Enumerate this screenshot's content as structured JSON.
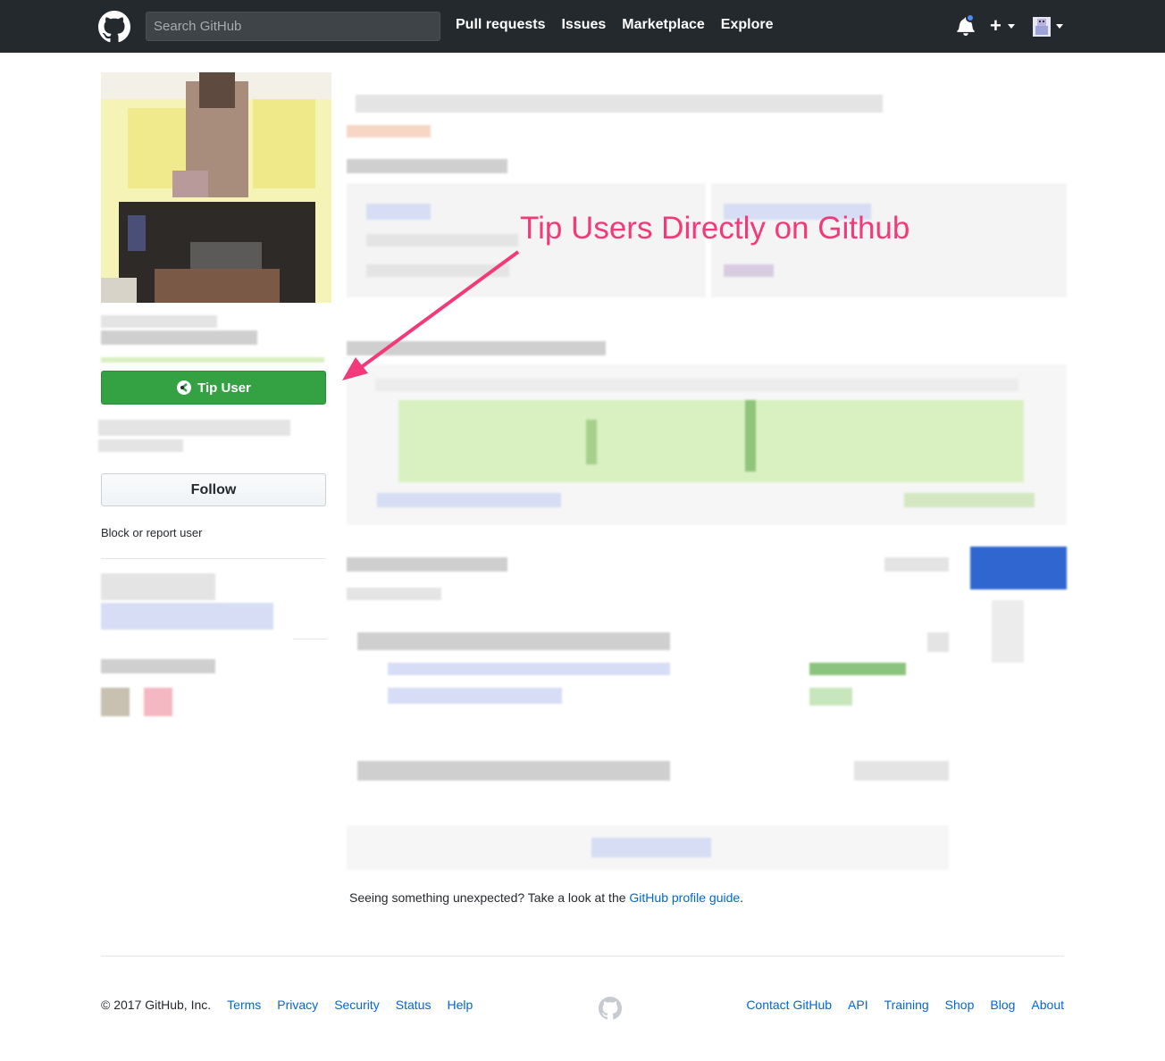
{
  "header": {
    "search_placeholder": "Search GitHub",
    "nav": [
      "Pull requests",
      "Issues",
      "Marketplace",
      "Explore"
    ],
    "plus": "+"
  },
  "sidebar": {
    "tip_button": "Tip User",
    "follow_button": "Follow",
    "block_link": "Block or report user"
  },
  "annotation": "Tip Users Directly on Github",
  "unexpected": {
    "text": "Seeing something unexpected? Take a look at the ",
    "link": "GitHub profile guide",
    "end": "."
  },
  "footer": {
    "copyright": "© 2017 GitHub, Inc.",
    "left_links": [
      "Terms",
      "Privacy",
      "Security",
      "Status",
      "Help"
    ],
    "right_links": [
      "Contact GitHub",
      "API",
      "Training",
      "Shop",
      "Blog",
      "About"
    ]
  },
  "colors": {
    "header_bg": "#24292e",
    "tip_green": "#34a143",
    "annotation_pink": "#f23a7a",
    "link_blue": "#0366d6"
  }
}
